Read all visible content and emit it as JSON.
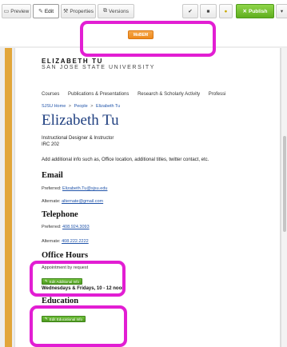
{
  "toolbar": {
    "preview_label": "Preview",
    "edit_label": "Edit",
    "properties_label": "Properties",
    "versions_label": "Versions",
    "publish_label": "Publish",
    "check_icon": "✔",
    "save_icon": "■",
    "pin_icon": "●",
    "more_icon": "▾"
  },
  "orange_button": {
    "label": "MoBEM"
  },
  "page": {
    "logo_name": "ELIZABETH TU",
    "logo_university": "SAN JOSE STATE UNIVERSITY",
    "nav_items": [
      "Courses",
      "Publications & Presentations",
      "Research & Scholarly Activity",
      "Professi"
    ],
    "breadcrumb": [
      "SJSU Home",
      "People",
      "Elizabeth Tu"
    ],
    "breadcrumb_sep": ">",
    "name": "Elizabeth Tu",
    "title": "Instructional Designer & Instructor",
    "office": "IRC 202",
    "add_info": "Add additional info such as, Office location, additional titles, twitter contact, etc.",
    "email": {
      "heading": "Email",
      "preferred_label": "Preferred:",
      "preferred_value": "Elizabeth.Tu@sjsu.edu",
      "alternate_label": "Alternate:",
      "alternate_value": "alternate@gmail.com"
    },
    "telephone": {
      "heading": "Telephone",
      "preferred_label": "Preferred:",
      "preferred_value": "408.924.3093",
      "alternate_label": "Alternate:",
      "alternate_value": "408.222.2222"
    },
    "office_hours": {
      "heading": "Office Hours",
      "appointment": "Appointment by request",
      "edit_button": "Edit Additional Info",
      "hours": "Wednesdays & Fridays, 10 - 12 noon"
    },
    "education": {
      "heading": "Education",
      "edit_button": "Edit Educational Info"
    }
  },
  "colors": {
    "highlight": "#e21ed3",
    "orange": "#ee8a1c",
    "green": "#4e9a20",
    "gold_strip": "#e2a63a",
    "name_blue": "#1f3f80"
  }
}
